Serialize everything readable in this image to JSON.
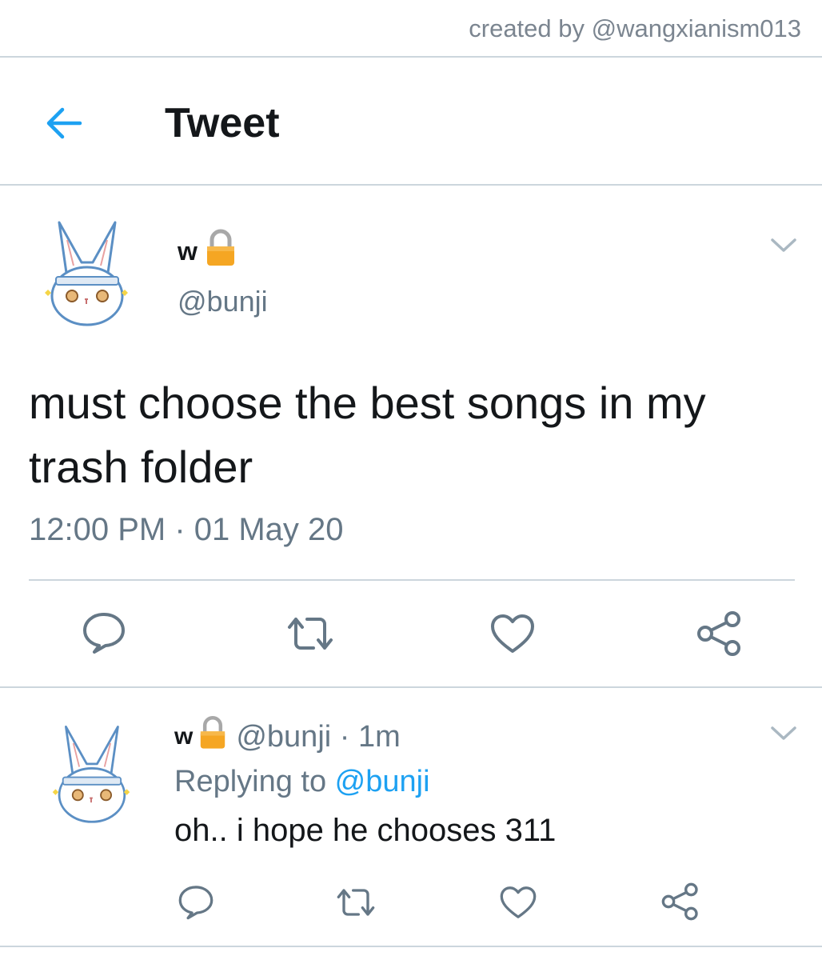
{
  "watermark": "created by @wangxianism013",
  "header": {
    "title": "Tweet",
    "back_icon": "arrow-left-icon"
  },
  "colors": {
    "accent": "#1da1f2",
    "muted": "#657786",
    "text": "#14171a",
    "divider": "#ccd6dd",
    "lock": "#f5a623"
  },
  "tweet": {
    "display_name": "w",
    "handle": "@bunji",
    "text": "must choose the best songs in my trash folder",
    "timestamp": "12:00 PM · 01 May 20",
    "actions": [
      "reply-icon",
      "retweet-icon",
      "like-icon",
      "share-icon"
    ]
  },
  "reply": {
    "display_name": "w",
    "handle_time": "@bunji · 1m",
    "replying_prefix": "Replying to ",
    "replying_mention": "@bunji",
    "text": "oh.. i hope he chooses 311",
    "actions": [
      "reply-icon",
      "retweet-icon",
      "like-icon",
      "share-icon"
    ]
  }
}
